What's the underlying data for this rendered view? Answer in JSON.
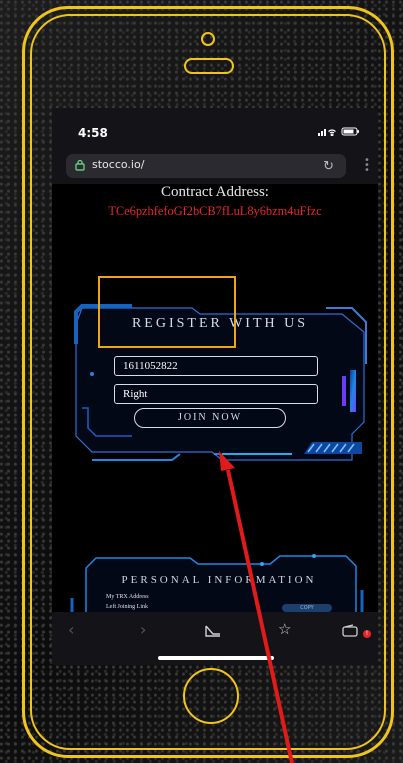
{
  "status_bar": {
    "time": "4:58",
    "icons": [
      "signal-icon",
      "wifi-icon",
      "battery-icon"
    ]
  },
  "browser": {
    "url": "stocco.io/",
    "toolbar_icons": [
      "back-icon",
      "forward-icon",
      "share-icon",
      "bookmark-icon",
      "wallet-icon"
    ],
    "wallet_badge": "!"
  },
  "contract": {
    "label": "Contract Address:",
    "address": "TCe6pzhfefoGf2bCB7fLuL8y6bzm4uFfzc"
  },
  "register": {
    "title": "REGISTER WITH US",
    "id_value": "1611052822",
    "side_value": "Right",
    "join_label": "JOIN NOW"
  },
  "personal": {
    "title": "PERSONAL INFORMATION",
    "trx_label": "My TRX Address",
    "link_label": "Left Joining Link",
    "copy_label": "COPY"
  },
  "colors": {
    "phone_outline": "#f0c419",
    "highlight": "#f0a31a",
    "arrow": "#e11a1a",
    "address": "#e8262a",
    "panel_accent": "#1e88e5"
  }
}
